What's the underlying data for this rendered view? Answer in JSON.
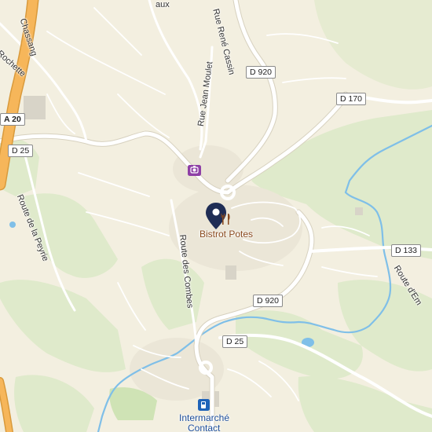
{
  "roads": {
    "highway": "A 20",
    "d25_west": "D 25",
    "d920_north": "D 920",
    "d170": "D 170",
    "d133": "D 133",
    "d920_south": "D 920",
    "d25_south": "D 25"
  },
  "streets": {
    "chassang": "Chassang",
    "rochette": "Rochette",
    "rue_rene_cassin": "Rue René Cassin",
    "rue_jean_moulet": "Rue Jean Moulet",
    "aux": "aux",
    "route_de_la_peyrie": "Route de la Peyrie",
    "route_des_combes": "Route des Combes",
    "route_demb": "Route d'Em"
  },
  "pois": {
    "restaurant_name": "Bistrot Potes",
    "supermarket_line1": "Intermarché",
    "supermarket_line2": "Contact"
  },
  "colors": {
    "land": "#f3efe0",
    "forest": "#dfeacb",
    "water": "#7fbfe8",
    "highway": "#f6b65a",
    "road": "#ffffff",
    "restaurant_pin": "#1f2d55",
    "restaurant_text": "#8a4a1e",
    "photo_poi": "#8e3fa6",
    "fuel_poi": "#1e63b8"
  },
  "icons": {
    "restaurant": "fork-knife-icon",
    "photo": "camera-icon",
    "fuel": "fuel-pump-icon",
    "pin": "map-pin-icon"
  }
}
